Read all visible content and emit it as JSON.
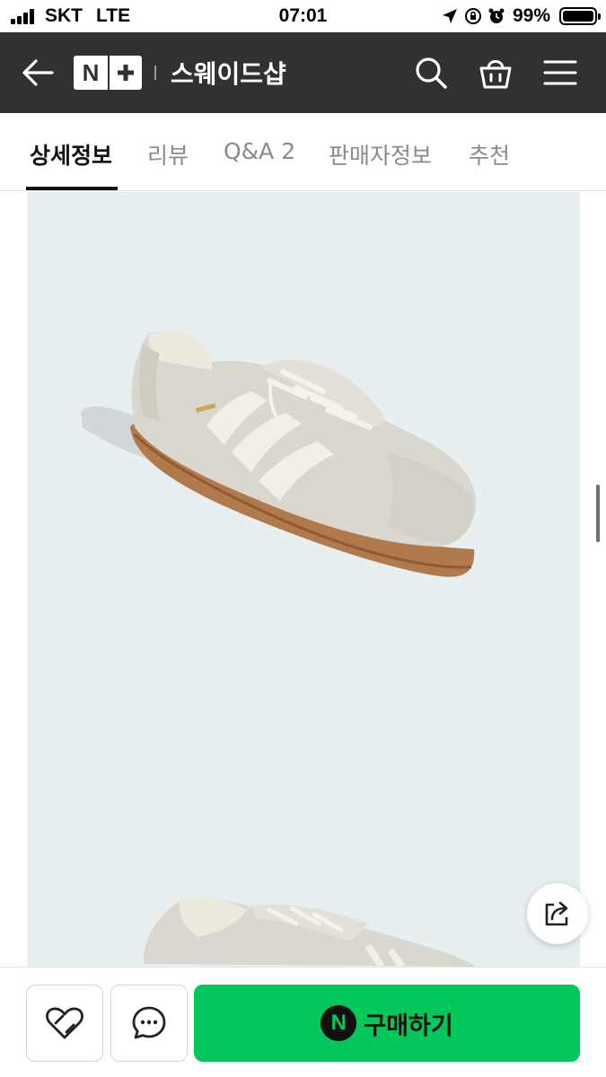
{
  "status_bar": {
    "carrier": "SKT",
    "network": "LTE",
    "time": "07:01",
    "battery_percent": "99%",
    "battery_level": 0.99
  },
  "header": {
    "logo_letter": "N",
    "shop_name": "스웨이드샵",
    "icons": [
      "back-arrow-icon",
      "search-icon",
      "shopping-bag-icon",
      "menu-icon"
    ],
    "background_color": "#2f3132"
  },
  "tabs": [
    {
      "label": "상세정보",
      "active": true
    },
    {
      "label": "리뷰",
      "active": false
    },
    {
      "label": "Q&A 2",
      "active": false
    },
    {
      "label": "판매자정보",
      "active": false
    },
    {
      "label": "추천",
      "active": false
    }
  ],
  "content": {
    "image_background": "#e8eff0",
    "share_icon": "share-icon"
  },
  "bottom_bar": {
    "like_icon": "heart-icon",
    "chat_icon": "chat-bubble-icon",
    "pay_icon_letter": "N",
    "buy_label": "구매하기",
    "accent_color": "#03c75a"
  }
}
